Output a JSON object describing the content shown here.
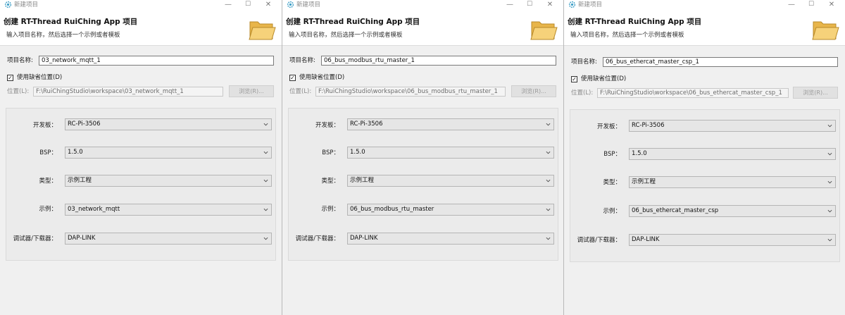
{
  "windows": [
    {
      "title": "新建项目",
      "header_title": "创建 RT-Thread RuiChing App 项目",
      "header_subtitle": "输入项目名称，然后选择一个示例或者模板",
      "project_name_label": "项目名称:",
      "project_name_value": "03_network_mqtt_1",
      "default_location_label": "使用缺省位置(D)",
      "default_location_checked": true,
      "location_label": "位置(L):",
      "location_value": "F:\\RuiChingStudio\\workspace\\03_network_mqtt_1",
      "browse_label": "浏览(R)...",
      "board_label": "开发板：",
      "board_value": "RC-Pi-3506",
      "bsp_label": "BSP：",
      "bsp_value": "1.5.0",
      "type_label": "类型：",
      "type_value": "示例工程",
      "example_label": "示例：",
      "example_value": "03_network_mqtt",
      "debugger_label": "调试器/下载器：",
      "debugger_value": "DAP-LINK"
    },
    {
      "title": "新建项目",
      "header_title": "创建 RT-Thread RuiChing App 项目",
      "header_subtitle": "输入项目名称，然后选择一个示例或者模板",
      "project_name_label": "项目名称:",
      "project_name_value": "06_bus_modbus_rtu_master_1",
      "default_location_label": "使用缺省位置(D)",
      "default_location_checked": true,
      "location_label": "位置(L):",
      "location_value": "F:\\RuiChingStudio\\workspace\\06_bus_modbus_rtu_master_1",
      "browse_label": "浏览(R)...",
      "board_label": "开发板：",
      "board_value": "RC-Pi-3506",
      "bsp_label": "BSP：",
      "bsp_value": "1.5.0",
      "type_label": "类型：",
      "type_value": "示例工程",
      "example_label": "示例：",
      "example_value": "06_bus_modbus_rtu_master",
      "debugger_label": "调试器/下载器：",
      "debugger_value": "DAP-LINK"
    },
    {
      "title": "新建项目",
      "header_title": "创建 RT-Thread RuiChing App 项目",
      "header_subtitle": "输入项目名称，然后选择一个示例或者模板",
      "project_name_label": "项目名称:",
      "project_name_value": "06_bus_ethercat_master_csp_1",
      "default_location_label": "使用缺省位置(D)",
      "default_location_checked": true,
      "location_label": "位置(L):",
      "location_value": "F:\\RuiChingStudio\\workspace\\06_bus_ethercat_master_csp_1",
      "browse_label": "浏览(R)...",
      "board_label": "开发板：",
      "board_value": "RC-Pi-3506",
      "bsp_label": "BSP：",
      "bsp_value": "1.5.0",
      "type_label": "类型：",
      "type_value": "示例工程",
      "example_label": "示例：",
      "example_value": "06_bus_ethercat_master_csp",
      "debugger_label": "调试器/下载器：",
      "debugger_value": "DAP-LINK"
    }
  ],
  "icons": {
    "app": "gear-icon",
    "minimize": "minimize-icon",
    "maximize": "maximize-icon",
    "close": "close-icon",
    "header": "folder-icon",
    "dropdown": "chevron-down-icon",
    "check": "checkmark-icon"
  },
  "colors": {
    "app_icon": "#3f9fc7",
    "folder_fill": "#f1c35a",
    "folder_edge": "#b88a2a"
  }
}
